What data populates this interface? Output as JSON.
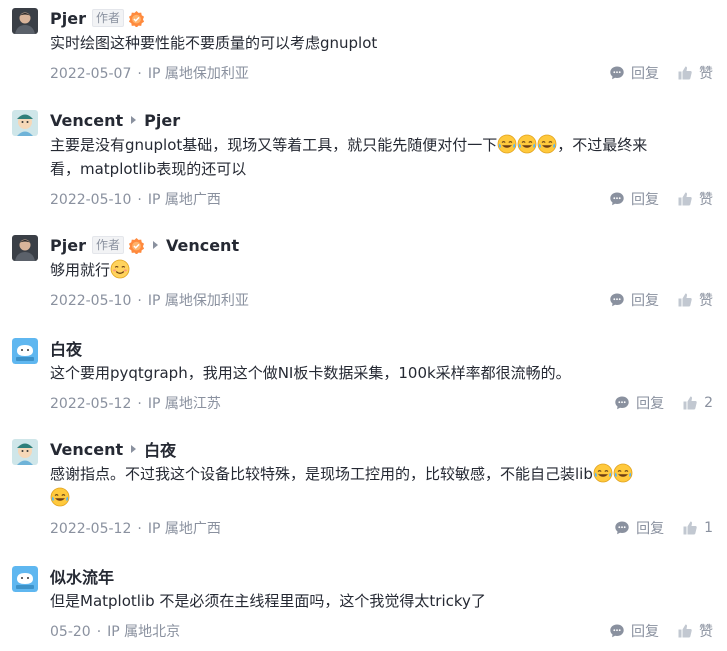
{
  "comments": [
    {
      "author": "Pjer",
      "author_tag": "作者",
      "reply_to": "",
      "text": "实时绘图这种要性能不要质量的可以考虑gnuplot",
      "text2": "",
      "date": "2022-05-07",
      "ip": "IP 属地保加利亚",
      "reply_label": "回复",
      "like_label": "赞"
    },
    {
      "author": "Vencent",
      "reply_to": "Pjer",
      "text": "主要是没有gnuplot基础，现场又等着工具，就只能先随便对付一下",
      "text_after": "，不过最终来",
      "text2": "看，matplotlib表现的还可以",
      "date": "2022-05-10",
      "ip": "IP 属地广西",
      "reply_label": "回复",
      "like_label": "赞"
    },
    {
      "author": "Pjer",
      "author_tag": "作者",
      "reply_to": "Vencent",
      "text": "够用就行",
      "date": "2022-05-10",
      "ip": "IP 属地保加利亚",
      "reply_label": "回复",
      "like_label": "赞"
    },
    {
      "author": "白夜",
      "text": "这个要用pyqtgraph，我用这个做NI板卡数据采集，100k采样率都很流畅的。",
      "date": "2022-05-12",
      "ip": "IP 属地江苏",
      "reply_label": "回复",
      "like_label": "2"
    },
    {
      "author": "Vencent",
      "reply_to": "白夜",
      "text": "感谢指点。不过我这个设备比较特殊，是现场工控用的，比较敏感，不能自己装lib",
      "date": "2022-05-12",
      "ip": "IP 属地广西",
      "reply_label": "回复",
      "like_label": "1"
    },
    {
      "author": "似水流年",
      "text": "但是Matplotlib 不是必须在主线程里面吗，这个我觉得太tricky了",
      "date": "05-20",
      "ip": "IP 属地北京",
      "reply_label": "回复",
      "like_label": "赞"
    }
  ],
  "icons": {
    "reply": "comment-icon",
    "like": "thumbs-up-icon",
    "level_badge": "level-badge-icon",
    "emoji": "laugh-cry-emoji",
    "emoji_smile": "smile-emoji"
  },
  "colors": {
    "name": "#252933",
    "meta": "#8a919f",
    "badge": "#ff8a3d"
  }
}
